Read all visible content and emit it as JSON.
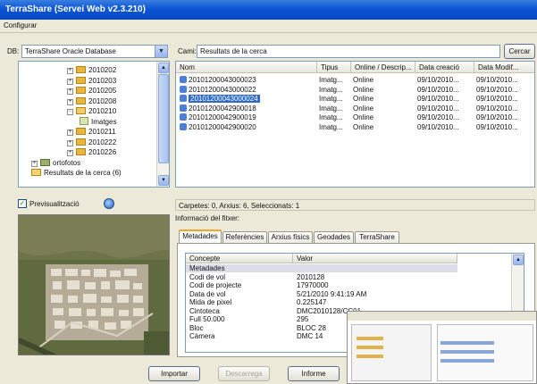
{
  "window": {
    "title": "TerraShare (Servei Web v2.3.210)"
  },
  "menu": {
    "configure": "Configurar"
  },
  "db": {
    "label": "DB:",
    "value": "TerraShare Oracle Database"
  },
  "tree": {
    "items": [
      {
        "label": "2010202",
        "type": "folder",
        "expander": "+"
      },
      {
        "label": "2010203",
        "type": "folder",
        "expander": "+"
      },
      {
        "label": "2010205",
        "type": "folder",
        "expander": "+"
      },
      {
        "label": "2010208",
        "type": "folder",
        "expander": "+"
      },
      {
        "label": "2010210",
        "type": "folder-open",
        "expander": "-"
      },
      {
        "label": "Imatges",
        "type": "images",
        "expander": ""
      },
      {
        "label": "2010211",
        "type": "folder",
        "expander": "+"
      },
      {
        "label": "2010222",
        "type": "folder",
        "expander": "+"
      },
      {
        "label": "2010226",
        "type": "folder",
        "expander": "+"
      },
      {
        "label": "ortofotos",
        "type": "layer",
        "expander": "+"
      },
      {
        "label": "Resultats de la cerca (6)",
        "type": "results",
        "expander": ""
      }
    ]
  },
  "search": {
    "label": "Cami:",
    "value": "Resultats de la cerca",
    "button": "Cercar"
  },
  "results": {
    "columns": [
      "Nom",
      "Tipus",
      "Online / Descrip...",
      "Data creació",
      "Data Modif..."
    ],
    "rows": [
      {
        "name": "20101200043000023",
        "type": "Imatg...",
        "online": "Online",
        "created": "09/10/2010...",
        "modified": "09/10/2010...",
        "selected": false
      },
      {
        "name": "20101200043000022",
        "type": "Imatg...",
        "online": "Online",
        "created": "09/10/2010...",
        "modified": "09/10/2010...",
        "selected": false
      },
      {
        "name": "20101200043000024",
        "type": "Imatg...",
        "online": "Online",
        "created": "09/10/2010...",
        "modified": "09/10/2010...",
        "selected": true
      },
      {
        "name": "20101200042900018",
        "type": "Imatg...",
        "online": "Online",
        "created": "09/10/2010...",
        "modified": "09/10/2010...",
        "selected": false
      },
      {
        "name": "20101200042900019",
        "type": "Imatg...",
        "online": "Online",
        "created": "09/10/2010...",
        "modified": "09/10/2010...",
        "selected": false
      },
      {
        "name": "20101200042900020",
        "type": "Imatg...",
        "online": "Online",
        "created": "09/10/2010...",
        "modified": "09/10/2010...",
        "selected": false
      }
    ]
  },
  "preview": {
    "label": "Previsualització",
    "checked": true
  },
  "status": {
    "text": "Carpetes: 0, Arxius: 6, Seleccionats: 1"
  },
  "info": {
    "title": "Informació del fitxer:",
    "tabs": [
      "Metadades",
      "Referències",
      "Arxius físics",
      "Geodades",
      "TerraShare"
    ],
    "columns": [
      "Concepte",
      "Valor"
    ],
    "rows": [
      {
        "concept": "Metadades",
        "value": "",
        "group": true
      },
      {
        "concept": "Codi de vol",
        "value": "2010128"
      },
      {
        "concept": "Codi de projecte",
        "value": "17970000"
      },
      {
        "concept": "Data de vol",
        "value": "5/21/2010 9:41:19 AM"
      },
      {
        "concept": "Mida de pixel",
        "value": "0.225147"
      },
      {
        "concept": "Cintoteca",
        "value": "DMC2010128/CC01"
      },
      {
        "concept": "Full 50.000",
        "value": "295"
      },
      {
        "concept": "Bloc",
        "value": "BLOC 28"
      },
      {
        "concept": "Càmera",
        "value": "DMC 14"
      }
    ]
  },
  "buttons": {
    "import": "Importar",
    "download": "Descarrega",
    "report": "Informe"
  },
  "colors": {
    "titlebar": "#0a55d6",
    "selection": "#316ac5",
    "window": "#ece9d8"
  }
}
